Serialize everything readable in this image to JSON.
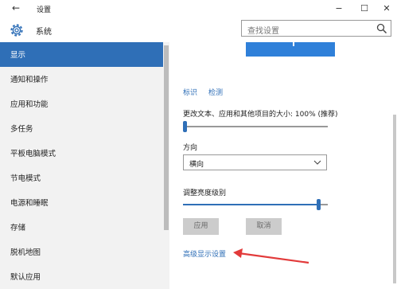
{
  "window": {
    "title": "设置",
    "back_glyph": "←",
    "minimize_glyph": "−",
    "maximize_glyph": "☐",
    "close_glyph": "✕"
  },
  "header": {
    "section_title": "系统",
    "search_placeholder": "查找设置",
    "icons": {
      "section": "gear-icon",
      "search": "search-icon"
    }
  },
  "sidebar": {
    "items": [
      {
        "label": "显示",
        "active": true
      },
      {
        "label": "通知和操作"
      },
      {
        "label": "应用和功能"
      },
      {
        "label": "多任务"
      },
      {
        "label": "平板电脑模式"
      },
      {
        "label": "节电模式"
      },
      {
        "label": "电源和睡眠"
      },
      {
        "label": "存储"
      },
      {
        "label": "脱机地图"
      },
      {
        "label": "默认应用"
      }
    ]
  },
  "display": {
    "identify_link": "标识",
    "detect_link": "检测",
    "scale_label": "更改文本、应用和其他项目的大小: 100% (推荐)",
    "scale_level": 0.0,
    "orientation_label": "方向",
    "orientation_value": "横向",
    "brightness_label": "调整亮度级别",
    "brightness_level": 0.95,
    "apply_button": "应用",
    "cancel_button": "取消",
    "advanced_link": "高级显示设置"
  },
  "colors": {
    "accent": "#2f6fb7",
    "monitor_preview": "#2f80d9",
    "annotation_arrow": "#e23a3a"
  }
}
